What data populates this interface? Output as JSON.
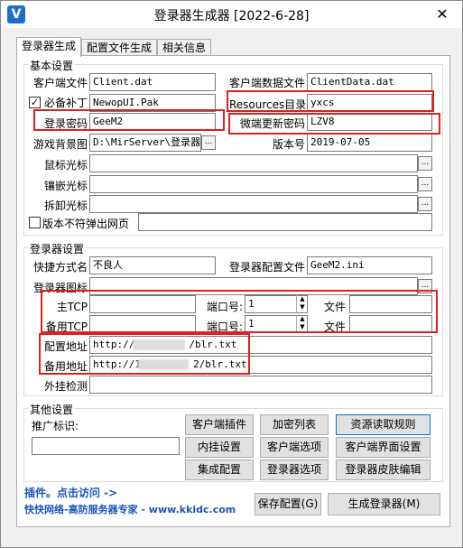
{
  "window": {
    "title": "登录器生成器 [2022-6-28]",
    "close_glyph": "✕",
    "icon_letter": "V"
  },
  "tabs": [
    "登录器生成",
    "配置文件生成",
    "相关信息"
  ],
  "basic": {
    "title": "基本设置",
    "client_file_label": "客户端文件",
    "client_file": "Client.dat",
    "client_data_label": "客户端数据文件",
    "client_data": "ClientData.dat",
    "patch_label": "必备补丁",
    "patch": "NewopUI.Pak",
    "resources_label": "Resources目录",
    "resources": "yxcs",
    "login_pwd_label": "登录密码",
    "login_pwd": "GeeM2",
    "micro_pwd_label": "微端更新密码",
    "micro_pwd": "LZV8",
    "bg_label": "游戏背景图",
    "bg": "D:\\MirServer\\登录器",
    "version_label": "版本号",
    "version": "2019-07-05",
    "mouse_label": "鼠标光标",
    "inlay_label": "镶嵌光标",
    "unload_label": "拆卸光标",
    "nopopup_label": "版本不符弹出网页",
    "check_mark": "✓"
  },
  "login": {
    "title": "登录器设置",
    "shortcut_label": "快捷方式名",
    "shortcut": "不良人",
    "config_label": "登录器配置文件",
    "config": "GeeM2.ini",
    "icon_label": "登录器图标",
    "main_tcp_label": "主TCP",
    "backup_tcp_label": "备用TCP",
    "port_label": "端口号:",
    "port_main": "1",
    "port_backup": "1",
    "file_label": "文件",
    "config_url_label": "配置地址",
    "config_url_prefix": "http://",
    "config_url_suffix": "/blr.txt",
    "backup_url_label": "备用地址",
    "backup_url_prefix": "http://1",
    "backup_url_suffix": "2/blr.txt",
    "plugin_check_label": "外挂检测"
  },
  "other": {
    "title": "其他设置",
    "promo_label": "推广标识:",
    "buttons": [
      "客户端插件",
      "加密列表",
      "资源读取规则",
      "内挂设置",
      "客户端选项",
      "客户端界面设置",
      "集成配置",
      "登录器选项",
      "登录器皮肤编辑"
    ]
  },
  "footer": {
    "plugin_link": "插件。点击访问 ->",
    "sponsor": "快快网络-高防服务器专家 - www.kkidc.com",
    "save_btn": "保存配置(G)",
    "generate_btn": "生成登录器(M)"
  },
  "colors": {
    "highlight": "#e0201b",
    "link": "#1b56b8"
  },
  "icons": {
    "dots": "...",
    "spin_up": "▲",
    "spin_down": "▼"
  }
}
